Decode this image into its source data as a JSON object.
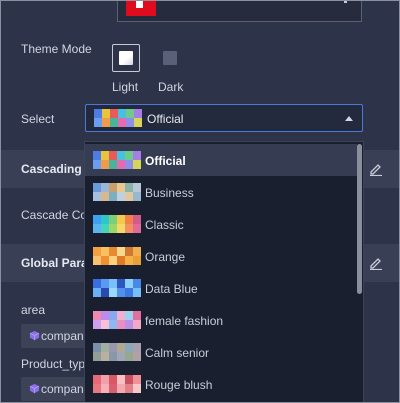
{
  "theme_mode": {
    "label": "Theme Mode",
    "options": [
      {
        "label": "Light",
        "selected": true
      },
      {
        "label": "Dark",
        "selected": false
      }
    ]
  },
  "select": {
    "label": "Select",
    "value": "Official"
  },
  "cascading_section": {
    "title": "Cascading C"
  },
  "cascade_field": {
    "label": "Cascade Co"
  },
  "global_section": {
    "title": "Global Para"
  },
  "params": [
    {
      "label": "area",
      "chip_text": "compan"
    },
    {
      "label": "Product_typ",
      "chip_text": "compan"
    }
  ],
  "dropdown": {
    "items": [
      {
        "label": "Official",
        "active": true,
        "colors": [
          "#4e7ce6",
          "#e8c43c",
          "#e85b5b",
          "#48c1e0",
          "#6ecb8a",
          "#a77de8",
          "#6a9ff0",
          "#f09a4a",
          "#4ab39a",
          "#e26bb2",
          "#8d8fe8",
          "#d6d65a"
        ]
      },
      {
        "label": "Business",
        "active": false,
        "colors": [
          "#6a9ad8",
          "#9ab6d8",
          "#c8a070",
          "#e8c890",
          "#8ab4a8",
          "#b8c8d8",
          "#a6c0e0",
          "#d8b890",
          "#7cb0c0",
          "#c0d0e0",
          "#e0c8a0",
          "#98b8d0"
        ]
      },
      {
        "label": "Classic",
        "active": false,
        "colors": [
          "#3ea0f0",
          "#2ec6c8",
          "#7ad07a",
          "#f2c94c",
          "#f27f4c",
          "#d05c8c",
          "#5ab4f0",
          "#44d4c0",
          "#9ad86a",
          "#f4d86a",
          "#f49060",
          "#e06a9a"
        ]
      },
      {
        "label": "Orange",
        "active": false,
        "colors": [
          "#f4a040",
          "#f8c060",
          "#e88a30",
          "#f8d890",
          "#d07830",
          "#f0b050",
          "#fac070",
          "#f09030",
          "#fcd080",
          "#e07a28",
          "#f8b048",
          "#eaa038"
        ]
      },
      {
        "label": "Data Blue",
        "active": false,
        "colors": [
          "#3a6ee0",
          "#5a9af0",
          "#7ac0f8",
          "#2e56c0",
          "#8ad0f8",
          "#4a88e8",
          "#6ab0f4",
          "#2a4ab0",
          "#9ad8fc",
          "#5090ec",
          "#3c78e4",
          "#78bcf8"
        ]
      },
      {
        "label": "female fashion",
        "active": false,
        "colors": [
          "#f08ab0",
          "#c08ae8",
          "#8aa8f0",
          "#f0b0d0",
          "#a0d0f0",
          "#e070a0",
          "#d0a0f0",
          "#f8c0d8",
          "#90b8f0",
          "#e890c0",
          "#b890e8",
          "#f4a8c8"
        ]
      },
      {
        "label": "Calm senior",
        "active": false,
        "colors": [
          "#7a90a8",
          "#a0b0a0",
          "#9898b0",
          "#b0a890",
          "#8aa8b8",
          "#a8a0b0",
          "#90a098",
          "#b8b0a0",
          "#8898a8",
          "#a0a8b8",
          "#98a890",
          "#b0a0a8"
        ]
      },
      {
        "label": "Rouge blush",
        "active": false,
        "colors": [
          "#e86a78",
          "#f0a0a8",
          "#d85868",
          "#f8c0c0",
          "#c85060",
          "#f09098",
          "#e87880",
          "#f8b0b8",
          "#d86070",
          "#f4a8b0",
          "#e08088",
          "#f8c8c8"
        ]
      }
    ]
  },
  "colors": {
    "background": "#2d3348",
    "section_bar": "#394056",
    "select_border": "#4a78d6",
    "dropdown_bg": "#1a1f2f",
    "active_item": "#363c52"
  }
}
